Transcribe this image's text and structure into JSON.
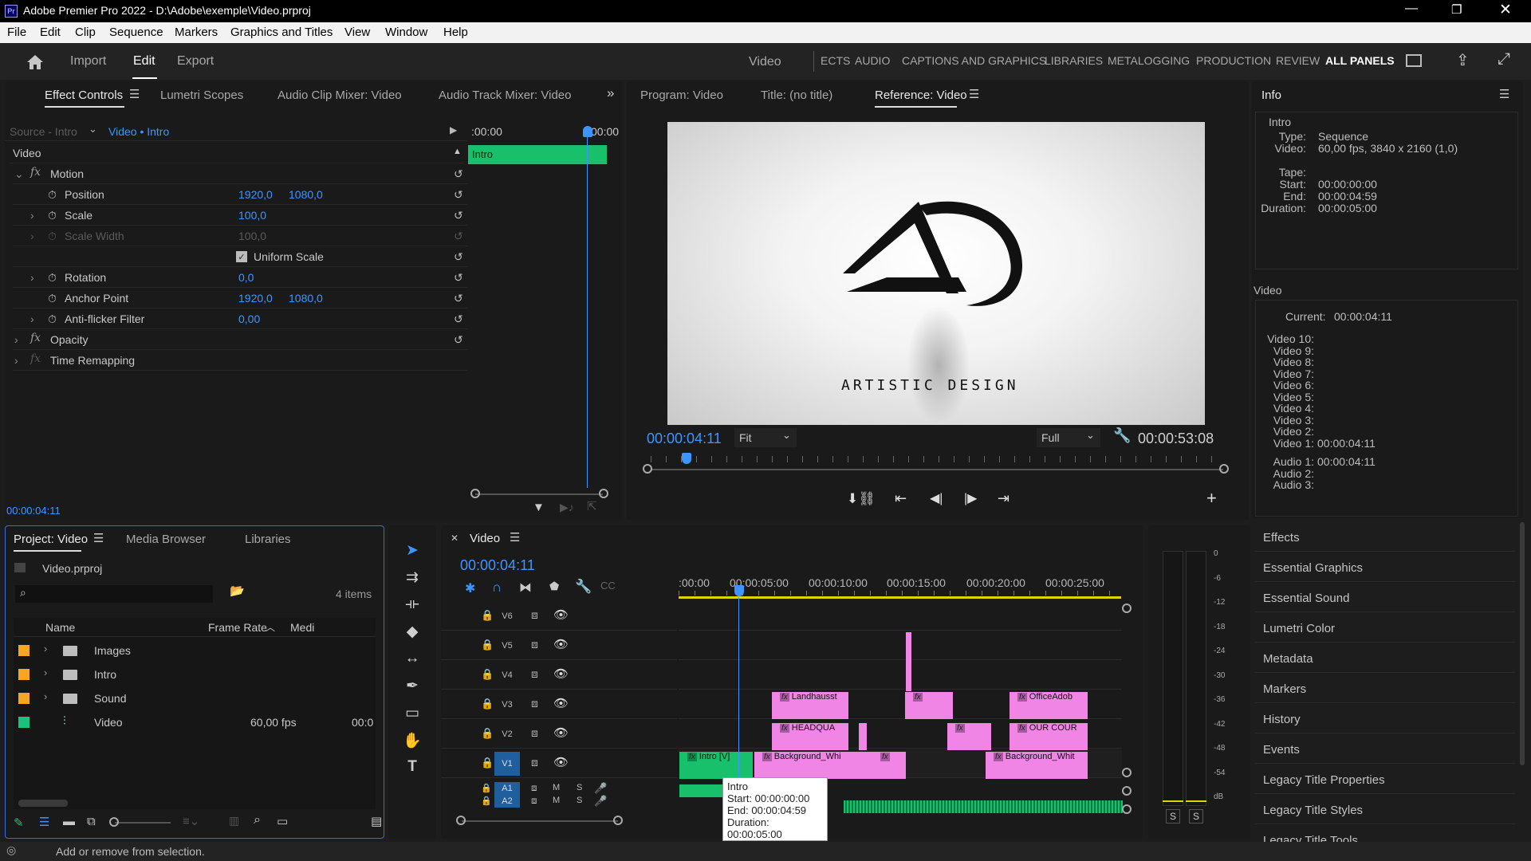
{
  "window": {
    "title": "Adobe Premier Pro 2022 - D:\\Adobe\\exemple\\Video.prproj",
    "app_icon": "Pr"
  },
  "menu": [
    "File",
    "Edit",
    "Clip",
    "Sequence",
    "Markers",
    "Graphics and Titles",
    "View",
    "Window",
    "Help"
  ],
  "workspace": {
    "left_tabs": [
      "Import",
      "Edit",
      "Export"
    ],
    "active": "Edit",
    "title": "Video",
    "panels": [
      "ECTS",
      "AUDIO",
      "CAPTIONS AND GRAPHICS",
      "LIBRARIES",
      "METALOGGING",
      "PRODUCTION",
      "REVIEW",
      "ALL PANELS"
    ]
  },
  "effect_controls": {
    "tabs": [
      "Effect Controls",
      "Lumetri Scopes",
      "Audio Clip Mixer: Video",
      "Audio Track Mixer: Video"
    ],
    "source": "Source - Intro",
    "target": "Video • Intro",
    "time_start": ":00:00",
    "time_end": "00:00",
    "clip_label": "Intro",
    "section": "Video",
    "motion": "Motion",
    "params": [
      {
        "name": "Position",
        "v1": "1920,0",
        "v2": "1080,0"
      },
      {
        "name": "Scale",
        "v1": "100,0",
        "v2": ""
      },
      {
        "name": "Scale Width",
        "v1": "100,0",
        "v2": ""
      },
      {
        "name": "Uniform Scale",
        "v1": "",
        "v2": ""
      },
      {
        "name": "Rotation",
        "v1": "0,0",
        "v2": ""
      },
      {
        "name": "Anchor Point",
        "v1": "1920,0",
        "v2": "1080,0"
      },
      {
        "name": "Anti-flicker Filter",
        "v1": "0,00",
        "v2": ""
      }
    ],
    "opacity": "Opacity",
    "time_remap": "Time Remapping",
    "timecode": "00:00:04:11"
  },
  "monitor": {
    "tabs": [
      "Program: Video",
      "Title: (no title)",
      "Reference: Video"
    ],
    "logo_text": "ARTISTIC DESIGN",
    "timecode": "00:00:04:11",
    "fit": "Fit",
    "quality": "Full",
    "duration": "00:00:53:08"
  },
  "info": {
    "title": "Info",
    "clip": "Intro",
    "rows1": [
      [
        "Type:",
        "Sequence"
      ],
      [
        "Video:",
        "60,00 fps, 3840 x 2160 (1,0)"
      ],
      [
        "",
        ""
      ],
      [
        "Tape:",
        ""
      ],
      [
        "Start:",
        "00:00:00:00"
      ],
      [
        "End:",
        "00:00:04:59"
      ],
      [
        "Duration:",
        "00:00:05:00"
      ]
    ],
    "video_title": "Video",
    "current_label": "Current:",
    "current": "00:00:04:11",
    "tracks": [
      [
        "Video 10:",
        ""
      ],
      [
        "Video 9:",
        ""
      ],
      [
        "Video 8:",
        ""
      ],
      [
        "Video 7:",
        ""
      ],
      [
        "Video 6:",
        ""
      ],
      [
        "Video 5:",
        ""
      ],
      [
        "Video 4:",
        ""
      ],
      [
        "Video 3:",
        ""
      ],
      [
        "Video 2:",
        ""
      ],
      [
        "Video 1:",
        "00:00:04:11"
      ]
    ],
    "audio": [
      [
        "Audio 1:",
        "00:00:04:11"
      ],
      [
        "Audio 2:",
        ""
      ],
      [
        "Audio 3:",
        ""
      ]
    ]
  },
  "side_panels": [
    "Effects",
    "Essential Graphics",
    "Essential Sound",
    "Lumetri Color",
    "Metadata",
    "Markers",
    "History",
    "Events",
    "Legacy Title Properties",
    "Legacy Title Styles",
    "Legacy Title Tools"
  ],
  "project": {
    "tabs": [
      "Project: Video",
      "Media Browser",
      "Libraries"
    ],
    "file": "Video.prproj",
    "items_count": "4 items",
    "col_name": "Name",
    "col_rate": "Frame Rate",
    "col_media": "Medi",
    "items": [
      {
        "name": "Images",
        "rate": "",
        "media": "",
        "color": "#f5a623",
        "type": "folder"
      },
      {
        "name": "Intro",
        "rate": "",
        "media": "",
        "color": "#f5a623",
        "type": "folder"
      },
      {
        "name": "Sound",
        "rate": "",
        "media": "",
        "color": "#f5a623",
        "type": "folder"
      },
      {
        "name": "Video",
        "rate": "60,00 fps",
        "media": "00:0",
        "color": "#19c37d",
        "type": "sequence"
      }
    ]
  },
  "timeline": {
    "name": "Video",
    "timecode": "00:00:04:11",
    "ruler": [
      ":00:00",
      "00:00:05:00",
      "00:00:10:00",
      "00:00:15:00",
      "00:00:20:00",
      "00:00:25:00"
    ],
    "video_tracks": [
      "V6",
      "V5",
      "V4",
      "V3",
      "V2",
      "V1"
    ],
    "audio_tracks": [
      "A1",
      "A2"
    ],
    "clips": {
      "landhaus": "Landhausst",
      "headqua": "HEADQUA",
      "office": "OfficeAdob",
      "ourcour": "OUR COUR",
      "intro": "Intro [V]",
      "bg1": "Background_Whi",
      "bg2": "Background_Whit"
    },
    "tooltip": {
      "title": "Intro",
      "start": "Start: 00:00:00:00",
      "end": "End: 00:00:04:59",
      "duration": "Duration: 00:00:05:00"
    },
    "meter_db": [
      "0",
      "-6",
      "-12",
      "-18",
      "-24",
      "-30",
      "-36",
      "-42",
      "-48",
      "-54",
      "dB"
    ],
    "solo": [
      "S",
      "S"
    ]
  },
  "status": "Add or remove from selection."
}
